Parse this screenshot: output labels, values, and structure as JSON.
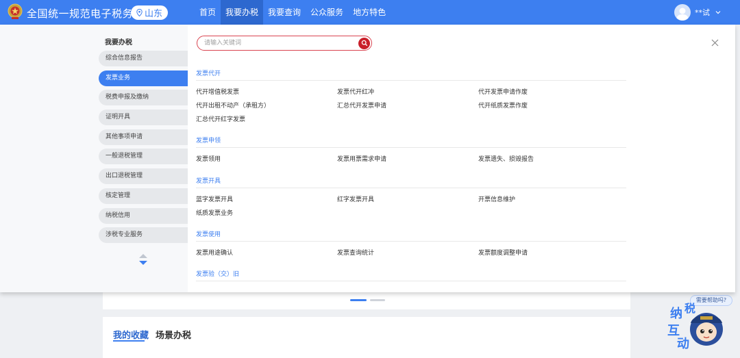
{
  "header": {
    "site_title": "全国统一规范电子税务局",
    "region": "山东",
    "nav": [
      "首页",
      "我要办税",
      "我要查询",
      "公众服务",
      "地方特色"
    ],
    "user_name": "**试"
  },
  "panel": {
    "sidebar_title": "我要办税",
    "sidebar_items": [
      "综合信息报告",
      "发票业务",
      "税费申报及缴纳",
      "证明开具",
      "其他事项申请",
      "一般退税管理",
      "出口退税管理",
      "核定管理",
      "纳税信用",
      "涉税专业服务"
    ],
    "active_item": "发票业务",
    "search_placeholder": "请输入关键词",
    "sections": [
      {
        "title": "发票代开",
        "links": [
          "代开增值税发票",
          "发票代开红冲",
          "代开发票申请作废",
          "代开出租不动产（承租方）",
          "汇总代开发票申请",
          "代开纸质发票作废",
          "汇总代开红字发票"
        ]
      },
      {
        "title": "发票申领",
        "links": [
          "发票领用",
          "发票用票需求申请",
          "发票遗失、损毁报告"
        ]
      },
      {
        "title": "发票开具",
        "links": [
          "蓝字发票开具",
          "红字发票开具",
          "开票信息维护",
          "纸质发票业务"
        ]
      },
      {
        "title": "发票使用",
        "links": [
          "发票用途确认",
          "发票查询统计",
          "发票额度调整申请"
        ]
      },
      {
        "title": "发票验（交）旧",
        "links": []
      }
    ]
  },
  "background": {
    "tabs": [
      "我的收藏",
      "场景办税"
    ]
  },
  "help": {
    "bubble": "需要帮助吗?",
    "mascot_text": "纳税互动"
  },
  "colors": {
    "primary": "#3d7ff0",
    "nav_active": "#2d68cf",
    "search_accent": "#c91f2a"
  }
}
